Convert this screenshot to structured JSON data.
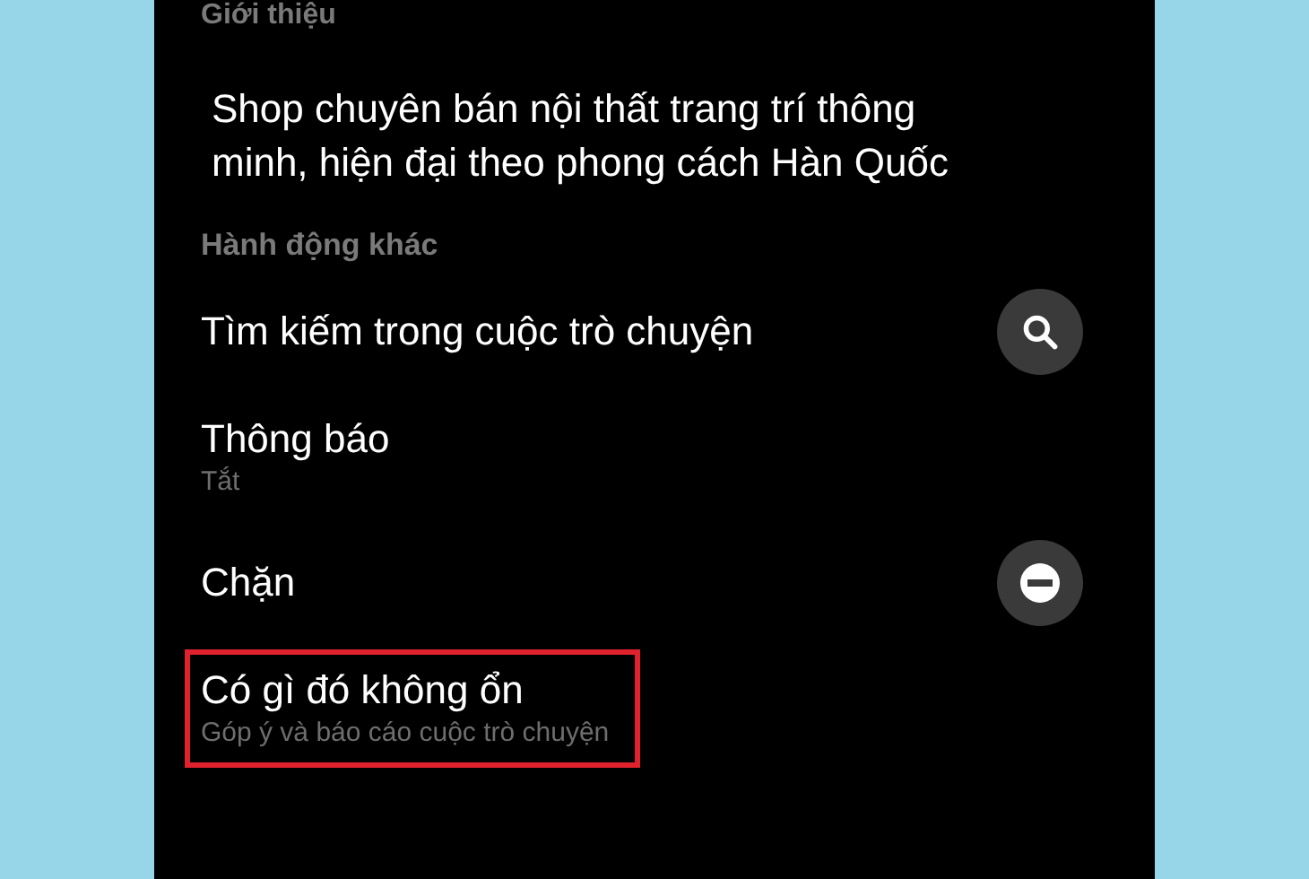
{
  "about": {
    "heading": "Giới thiệu",
    "description": "Shop chuyên bán nội thất trang trí thông minh, hiện đại theo phong cách Hàn Quốc"
  },
  "actions": {
    "heading": "Hành động khác",
    "items": [
      {
        "label": "Tìm kiếm trong cuộc trò chuyện",
        "kind": "search",
        "highlighted": false
      },
      {
        "label": "Thông báo",
        "subtitle": "Tắt",
        "highlighted": false
      },
      {
        "label": "Chặn",
        "kind": "block",
        "highlighted": false
      },
      {
        "label": "Có gì đó không ổn",
        "subtitle": "Góp ý và báo cáo cuộc trò chuyện",
        "highlighted": true
      }
    ]
  }
}
